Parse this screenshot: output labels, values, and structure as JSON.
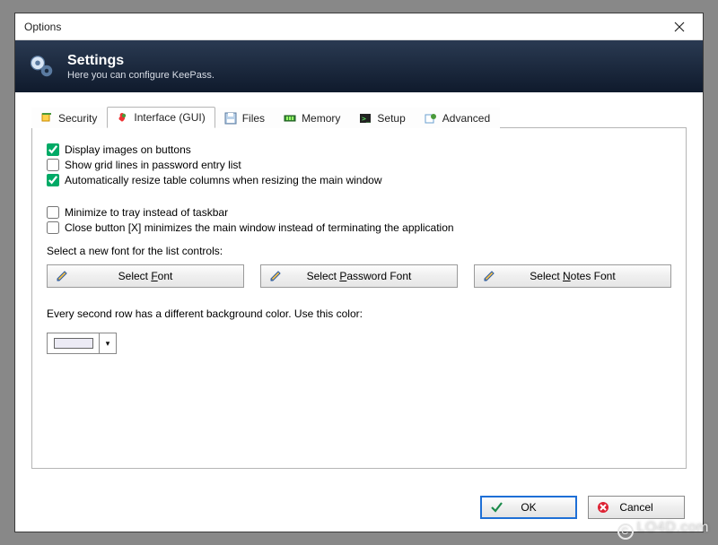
{
  "window": {
    "title": "Options"
  },
  "header": {
    "title": "Settings",
    "subtitle": "Here you can configure KeePass."
  },
  "tabs": [
    {
      "label": "Security"
    },
    {
      "label": "Interface (GUI)"
    },
    {
      "label": "Files"
    },
    {
      "label": "Memory"
    },
    {
      "label": "Setup"
    },
    {
      "label": "Advanced"
    }
  ],
  "checks": {
    "displayImages": {
      "label": "Display images on buttons",
      "checked": true
    },
    "gridLines": {
      "label": "Show grid lines in password entry list",
      "checked": false
    },
    "autoResize": {
      "label": "Automatically resize table columns when resizing the main window",
      "checked": true
    },
    "minimizeTray": {
      "label": "Minimize to tray instead of taskbar",
      "checked": false
    },
    "closeMinimizes": {
      "label": "Close button [X] minimizes the main window instead of terminating the application",
      "checked": false
    }
  },
  "labels": {
    "fontIntro": "Select a new font for the list controls:",
    "rowColorIntro": "Every second row has a different background color. Use this color:"
  },
  "buttons": {
    "selectFont_pre": "Select ",
    "selectFont_u": "F",
    "selectFont_post": "ont",
    "selectPwFont_pre": "Select ",
    "selectPwFont_u": "P",
    "selectPwFont_post": "assword Font",
    "selectNotesFont_pre": "Select ",
    "selectNotesFont_u": "N",
    "selectNotesFont_post": "otes Font",
    "ok": "OK",
    "cancel": "Cancel"
  },
  "color": {
    "altRow": "#ecebf5"
  },
  "watermark": "LO4D.com"
}
